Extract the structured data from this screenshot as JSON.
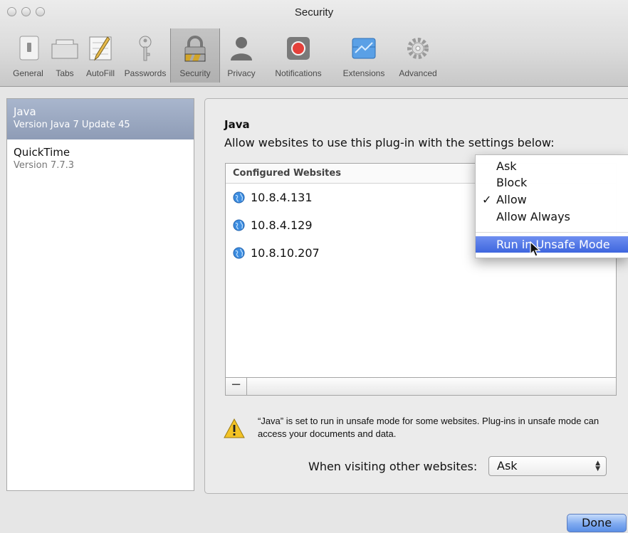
{
  "window": {
    "title": "Security"
  },
  "toolbar": {
    "items": [
      {
        "label": "General",
        "icon": "switch-icon"
      },
      {
        "label": "Tabs",
        "icon": "tabs-icon"
      },
      {
        "label": "AutoFill",
        "icon": "pencil-icon"
      },
      {
        "label": "Passwords",
        "icon": "key-icon"
      },
      {
        "label": "Security",
        "icon": "lock-icon",
        "selected": true
      },
      {
        "label": "Privacy",
        "icon": "person-icon"
      },
      {
        "label": "Notifications",
        "icon": "notification-icon"
      },
      {
        "label": "Extensions",
        "icon": "puzzle-icon"
      },
      {
        "label": "Advanced",
        "icon": "gear-icon"
      }
    ]
  },
  "sidebar": {
    "plugins": [
      {
        "name": "Java",
        "version": "Version Java 7 Update 45",
        "selected": true
      },
      {
        "name": "QuickTime",
        "version": "Version 7.7.3"
      }
    ]
  },
  "main": {
    "plugin_title": "Java",
    "description": "Allow websites to use this plug-in with the settings below:",
    "table_header": "Configured Websites",
    "websites": [
      "10.8.4.131",
      "10.8.4.129",
      "10.8.10.207"
    ],
    "remove_button": "−",
    "warning": "“Java” is set to run in unsafe mode for some websites. Plug-ins in unsafe mode can access your documents and data.",
    "other_label": "When visiting other websites:",
    "other_value": "Ask"
  },
  "menu": {
    "items": [
      "Ask",
      "Block",
      "Allow",
      "Allow Always"
    ],
    "checked": "Allow",
    "highlighted": "Run in Unsafe Mode"
  },
  "footer": {
    "done_label": "Done"
  },
  "colors": {
    "selection": "#3e66de",
    "sidebar_selected": "#97a5be",
    "done": "#7faaf0"
  }
}
